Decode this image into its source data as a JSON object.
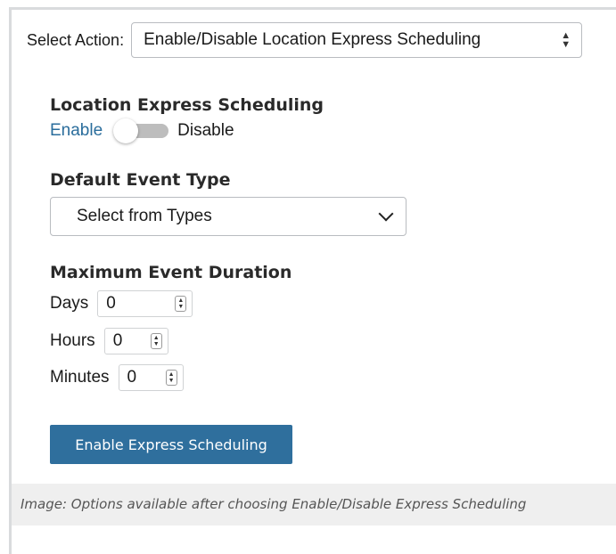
{
  "action": {
    "label": "Select Action:",
    "selected": "Enable/Disable Location Express Scheduling",
    "icon": "up-down-arrows-icon"
  },
  "express": {
    "title": "Location Express Scheduling",
    "enable_label": "Enable",
    "disable_label": "Disable",
    "state": "Enable"
  },
  "event_type": {
    "title": "Default Event Type",
    "selected": "Select from Types",
    "icon": "chevron-down-icon"
  },
  "duration": {
    "title": "Maximum Event Duration",
    "fields": [
      {
        "label": "Days",
        "value": "0"
      },
      {
        "label": "Hours",
        "value": "0"
      },
      {
        "label": "Minutes",
        "value": "0"
      }
    ]
  },
  "button": {
    "label": "Enable Express Scheduling",
    "color": "#2f6f9d"
  },
  "caption": "Image: Options available after choosing Enable/Disable Express Scheduling"
}
